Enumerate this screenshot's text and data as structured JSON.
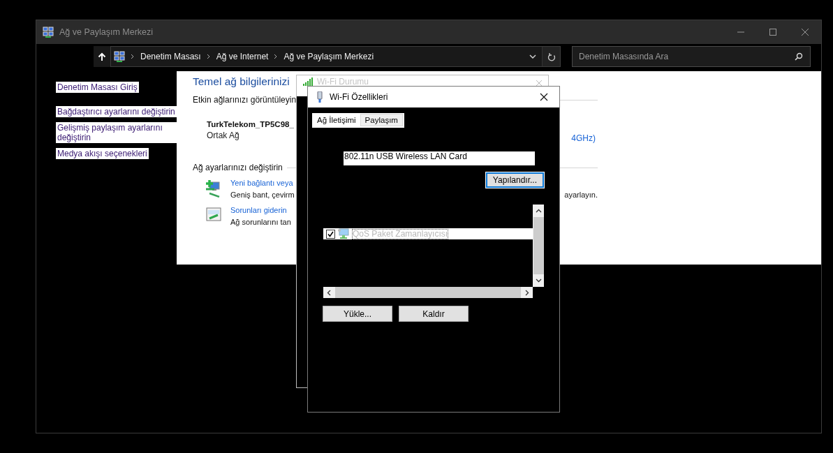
{
  "window": {
    "title": "Ağ ve Paylaşım Merkezi"
  },
  "nav": {
    "breadcrumbs": [
      "Denetim Masası",
      "Ağ ve Internet",
      "Ağ ve Paylaşım Merkezi"
    ],
    "search": {
      "placeholder": "Denetim Masasında Ara"
    }
  },
  "sidebar": {
    "links": [
      "Denetim Masası Giriş",
      "Bağdaştırıcı ayarlarını değiştirin",
      "Gelişmiş paylaşım ayarlarını değiştirin",
      "Medya akışı seçenekleri"
    ]
  },
  "content": {
    "heading": "Temel ağ bilgilerinizi",
    "active_label": "Etkin ağlarınızı görüntüleyin",
    "network": {
      "name": "TurkTelekom_TP5C98_",
      "type": "Ortak Ağ",
      "connection_fragment": "4GHz)"
    },
    "settings_label": "Ağ ayarlarınızı değiştirin",
    "tasks": [
      {
        "kind": "new-connection",
        "link": "Yeni bağlantı veya",
        "description": "Geniş bant, çevirm",
        "description_end": "ayarlayın."
      },
      {
        "kind": "troubleshoot",
        "link": "Sorunları giderin",
        "description": "Ağ sorunlarını tan"
      }
    ]
  },
  "status_dialog": {
    "title": "Wi-Fi Durumu"
  },
  "properties_dialog": {
    "title": "Wi-Fi Özellikleri",
    "tabs": [
      {
        "label": "Ağ İletişimi",
        "selected": true
      },
      {
        "label": "Paylaşım",
        "selected": false
      }
    ],
    "adapter": "802.11n USB Wireless LAN Card",
    "configure_button": {
      "label": "Yapılandır...",
      "focused": true
    },
    "components": [
      {
        "label": "QoS Paket Zamanlayıcısı",
        "checked": true,
        "selected": true
      }
    ],
    "buttons": [
      "Yükle...",
      "Kaldır"
    ]
  }
}
